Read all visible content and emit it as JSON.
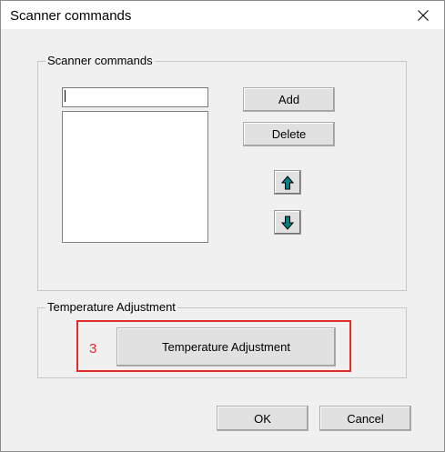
{
  "window": {
    "title": "Scanner commands",
    "close_icon": "close-icon"
  },
  "scanner_group": {
    "legend": "Scanner commands",
    "command_input": {
      "value": "",
      "placeholder": ""
    },
    "command_list": {
      "items": []
    },
    "add_label": "Add",
    "delete_label": "Delete",
    "move_up_icon": "arrow-up-icon",
    "move_down_icon": "arrow-down-icon",
    "arrow_color": "#008080"
  },
  "temperature_group": {
    "legend": "Temperature Adjustment",
    "button_label": "Temperature Adjustment"
  },
  "annotation": {
    "step_number": "3",
    "color": "#e22b2b"
  },
  "footer": {
    "ok_label": "OK",
    "cancel_label": "Cancel"
  }
}
